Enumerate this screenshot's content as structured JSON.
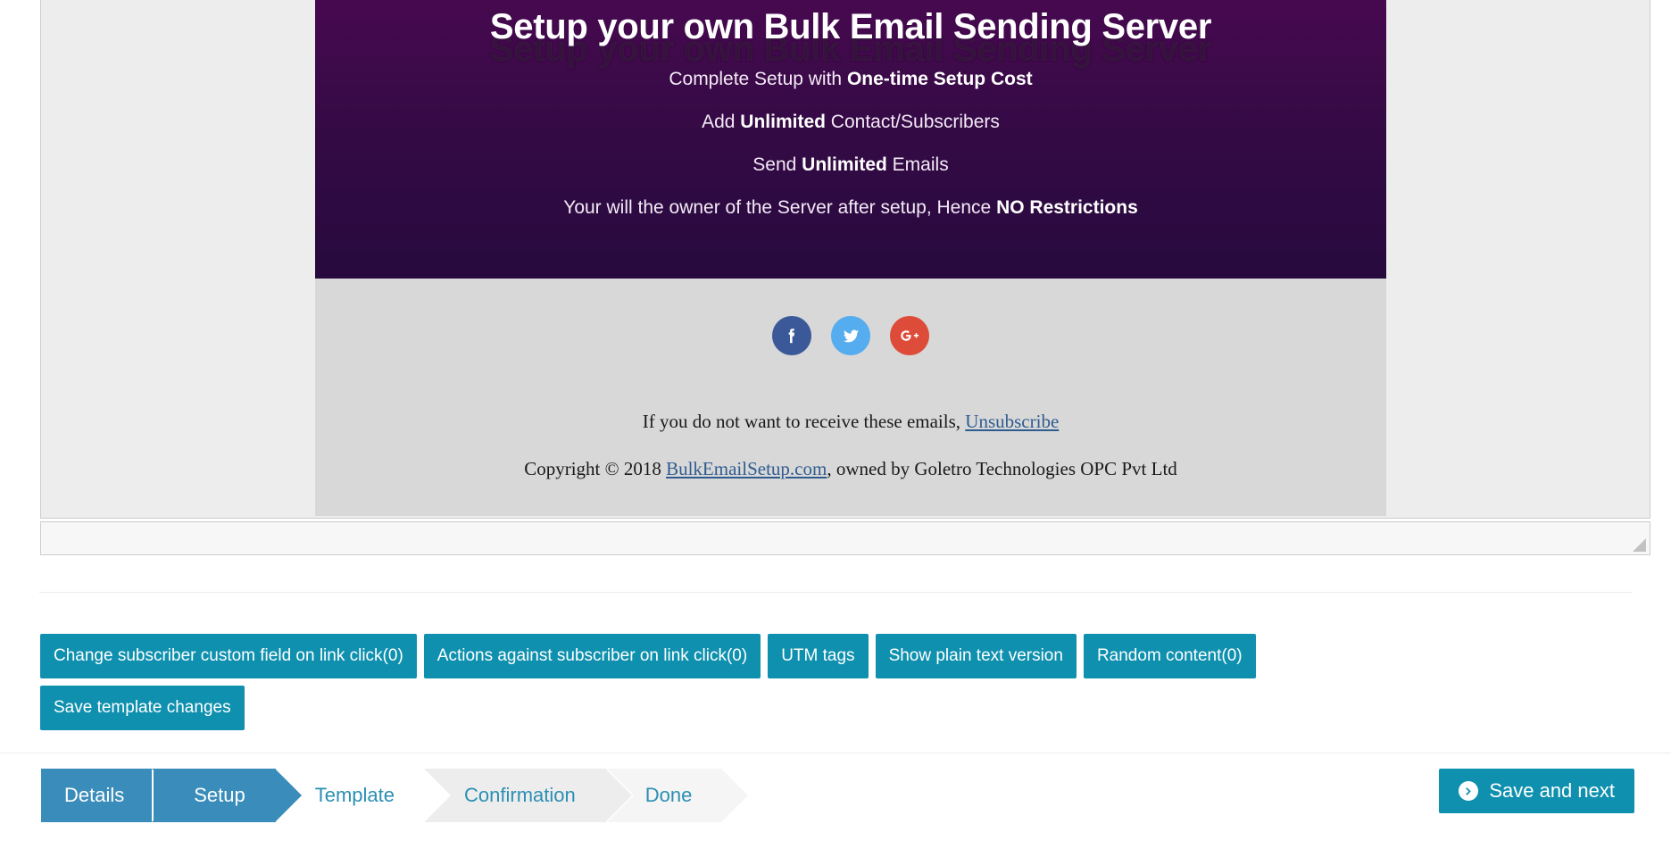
{
  "email_preview": {
    "header": {
      "title": "Setup your own Bulk Email Sending Server",
      "title_ghost": "Setup your own Bulk Email Sending Server",
      "lines": [
        {
          "pre": "Complete Setup with ",
          "bold": "One-time Setup Cost",
          "post": ""
        },
        {
          "pre": "Add ",
          "bold": "Unlimited",
          "post": " Contact/Subscribers"
        },
        {
          "pre": "Send ",
          "bold": "Unlimited",
          "post": " Emails"
        },
        {
          "pre": "Your will the owner of the Server after setup, Hence ",
          "bold": "NO Restrictions",
          "post": ""
        }
      ],
      "background_top": "#47094f",
      "background_bottom": "#270a3e"
    },
    "social_icons": [
      {
        "name": "facebook-icon",
        "label": "Facebook",
        "color": "#3b5998"
      },
      {
        "name": "twitter-icon",
        "label": "Twitter",
        "color": "#55acee"
      },
      {
        "name": "google-plus-icon",
        "label": "Google Plus",
        "color": "#dd4b39"
      }
    ],
    "footer": {
      "unsubscribe_text": "If you do not want to receive these emails, ",
      "unsubscribe_link": "Unsubscribe",
      "copyright_pre": "Copyright © 2018 ",
      "copyright_link": "BulkEmailSetup.com",
      "copyright_post": ", owned by Goletro Technologies OPC Pvt Ltd"
    },
    "body_background": "#d8d8d8",
    "canvas_background": "#ededed"
  },
  "actions": {
    "row1": [
      "Change subscriber custom field on link click(0)",
      "Actions against subscriber on link click(0)",
      "UTM tags",
      "Show plain text version",
      "Random content(0)"
    ],
    "row2": [
      "Save template changes"
    ],
    "button_color": "#0e90ae"
  },
  "wizard": {
    "steps": [
      {
        "label": "Details",
        "state": "done"
      },
      {
        "label": "Setup",
        "state": "done"
      },
      {
        "label": "Template",
        "state": "current"
      },
      {
        "label": "Confirmation",
        "state": "future"
      },
      {
        "label": "Done",
        "state": "future"
      }
    ],
    "active_color": "#3a8dba",
    "link_color": "#2b8fb3",
    "save_next_label": "Save and next",
    "save_next_icon": "arrow-circle-right-icon"
  }
}
